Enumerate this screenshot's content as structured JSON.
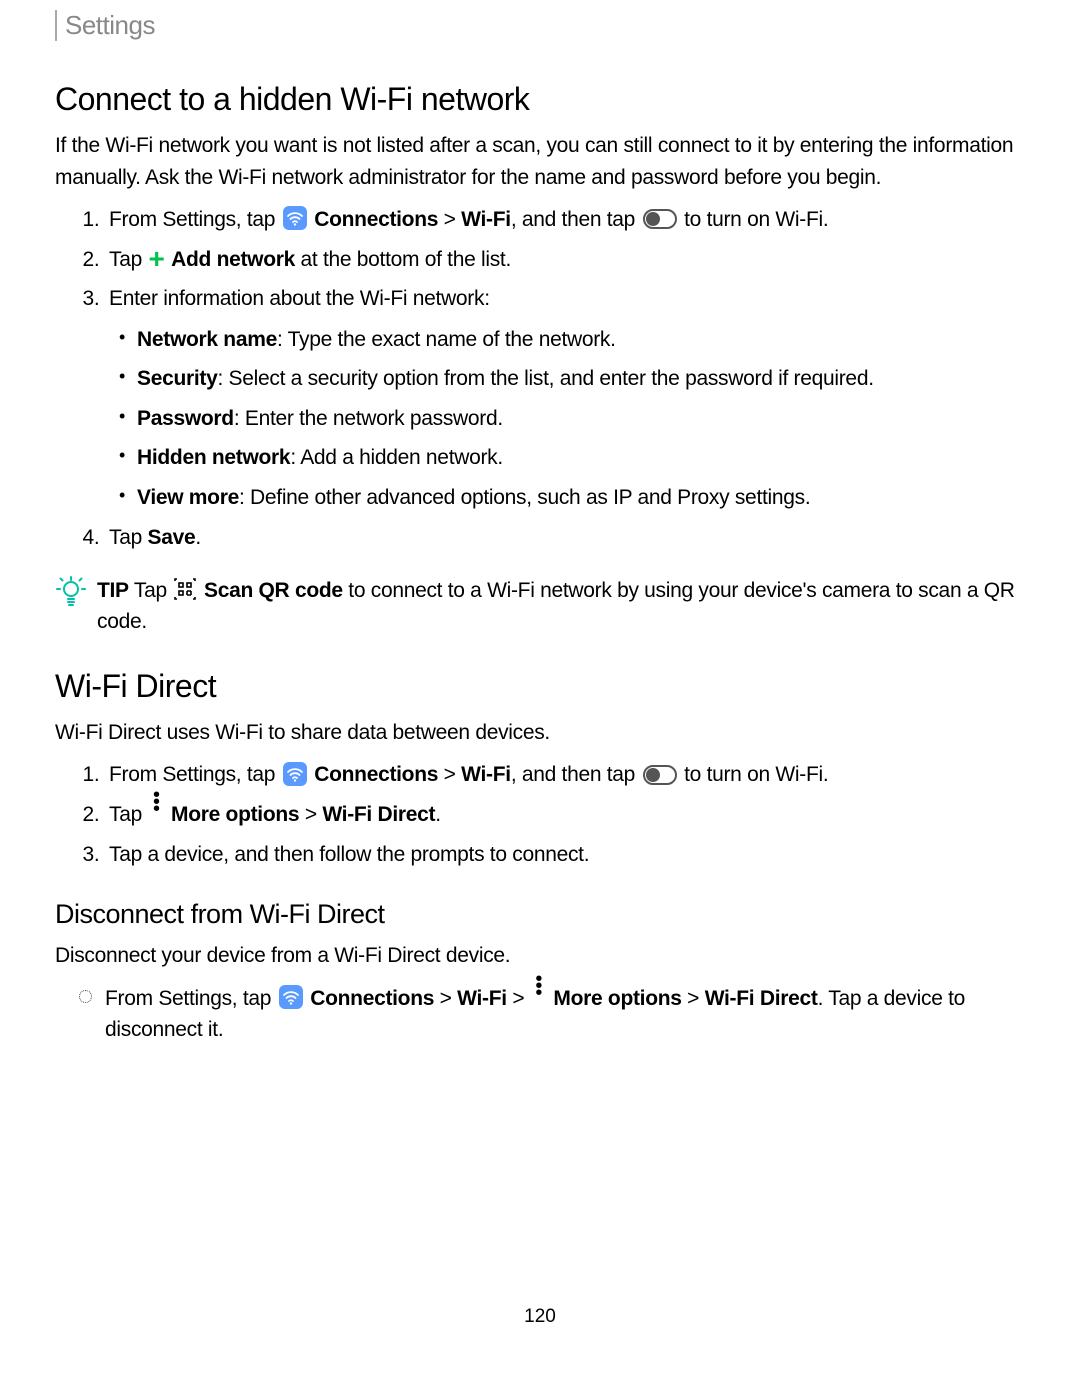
{
  "header": {
    "label": "Settings"
  },
  "s1": {
    "title": "Connect to a hidden Wi-Fi network",
    "intro": "If the Wi-Fi network you want is not listed after a scan, you can still connect to it by entering the information manually. Ask the Wi-Fi network administrator for the name and password before you begin.",
    "step1_a": "From Settings, tap ",
    "step1_conn": "Connections",
    "step1_gt": " > ",
    "step1_wifi": "Wi-Fi",
    "step1_b": ", and then tap ",
    "step1_c": " to turn on Wi-Fi.",
    "step2_a": "Tap ",
    "step2_addnet": "Add network",
    "step2_b": " at the bottom of the list.",
    "step3": "Enter information about the Wi-Fi network:",
    "sub": {
      "nn_l": "Network name",
      "nn_t": ": Type the exact name of the network.",
      "sec_l": "Security",
      "sec_t": ": Select a security option from the list, and enter the password if required.",
      "pw_l": "Password",
      "pw_t": ": Enter the network password.",
      "hn_l": "Hidden network",
      "hn_t": ": Add a hidden network.",
      "vm_l": "View more",
      "vm_t": ": Define other advanced options, such as IP and Proxy settings."
    },
    "step4_a": "Tap ",
    "step4_save": "Save",
    "step4_b": "."
  },
  "tip": {
    "label": "TIP",
    "a": "  Tap ",
    "scan": "Scan QR code",
    "b": " to connect to a Wi-Fi network by using your device's camera to scan a QR code."
  },
  "s2": {
    "title": "Wi-Fi Direct",
    "intro": "Wi-Fi Direct uses Wi-Fi to share data between devices.",
    "step1_a": "From Settings, tap ",
    "step1_conn": "Connections",
    "step1_gt": " > ",
    "step1_wifi": "Wi-Fi",
    "step1_b": ", and then tap ",
    "step1_c": " to turn on Wi-Fi.",
    "step2_a": "Tap ",
    "step2_more": "More options",
    "step2_gt": " > ",
    "step2_wfd": "Wi-Fi Direct",
    "step2_b": ".",
    "step3": "Tap a device, and then follow the prompts to connect."
  },
  "s3": {
    "title": "Disconnect from Wi-Fi Direct",
    "intro": "Disconnect your device from a Wi-Fi Direct device.",
    "b_a": "From Settings, tap ",
    "b_conn": "Connections",
    "b_gt1": " > ",
    "b_wifi": "Wi-Fi",
    "b_gt2": " > ",
    "b_more": "More options",
    "b_gt3": " > ",
    "b_wfd": "Wi-Fi Direct",
    "b_b": ". Tap a device to disconnect it."
  },
  "page_number": "120"
}
